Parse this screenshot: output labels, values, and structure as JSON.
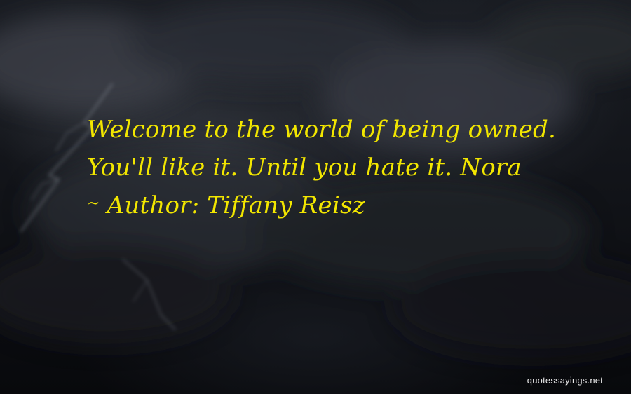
{
  "quote": {
    "line1": "Welcome to the world of being owned.",
    "line2": "You'll like it. Until you hate it. Nora",
    "author_prefix": "~",
    "author_label": "Author:",
    "author_name": "Tiffany Reisz"
  },
  "footer": {
    "watermark": "quotessayings.net"
  },
  "colors": {
    "quote_text": "#f2e600",
    "watermark": "#e9e9e9",
    "background": "#121419"
  }
}
